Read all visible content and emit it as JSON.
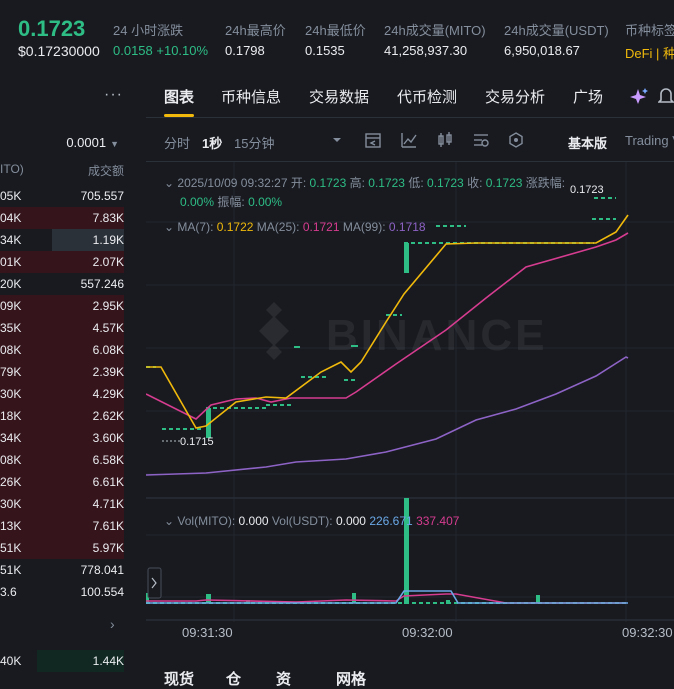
{
  "ticker": {
    "price": "0.1723",
    "price_usd": "$0.17230000",
    "stats": [
      {
        "label": "24 小时涨跌",
        "value": "0.0158 +10.10%"
      },
      {
        "label": "24h最高价",
        "value": "0.1798"
      },
      {
        "label": "24h最低价",
        "value": "0.1535"
      },
      {
        "label": "24h成交量(MITO)",
        "value": "41,258,937.30"
      },
      {
        "label": "24h成交量(USDT)",
        "value": "6,950,018.67"
      },
      {
        "label": "币种标签",
        "value": "DeFi | 种"
      }
    ]
  },
  "orderbook": {
    "more": "···",
    "step": "0.0001",
    "col1": "ITO)",
    "col2": "成交额",
    "rows": [
      {
        "q": "05K",
        "v": "705.557",
        "side": "ask",
        "fill": 0.0
      },
      {
        "q": "04K",
        "v": "7.83K",
        "side": "ask",
        "fill": 1.0
      },
      {
        "q": "34K",
        "v": "1.19K",
        "side": "ask",
        "fill": 0.58
      },
      {
        "q": "01K",
        "v": "2.07K",
        "side": "ask",
        "fill": 1.0
      },
      {
        "q": "20K",
        "v": "557.246",
        "side": "ask",
        "fill": 0.0
      },
      {
        "q": "09K",
        "v": "2.95K",
        "side": "ask",
        "fill": 1.0
      },
      {
        "q": "35K",
        "v": "4.57K",
        "side": "ask",
        "fill": 1.0
      },
      {
        "q": "08K",
        "v": "6.08K",
        "side": "ask",
        "fill": 1.0
      },
      {
        "q": "79K",
        "v": "2.39K",
        "side": "ask",
        "fill": 1.0
      },
      {
        "q": "30K",
        "v": "4.29K",
        "side": "ask",
        "fill": 1.0
      },
      {
        "q": "18K",
        "v": "2.62K",
        "side": "ask",
        "fill": 1.0
      },
      {
        "q": "34K",
        "v": "3.60K",
        "side": "ask",
        "fill": 1.0
      },
      {
        "q": "08K",
        "v": "6.58K",
        "side": "ask",
        "fill": 1.0
      },
      {
        "q": "26K",
        "v": "6.61K",
        "side": "ask",
        "fill": 1.0
      },
      {
        "q": "30K",
        "v": "4.71K",
        "side": "ask",
        "fill": 1.0
      },
      {
        "q": "13K",
        "v": "7.61K",
        "side": "ask",
        "fill": 1.0
      },
      {
        "q": "51K",
        "v": "5.97K",
        "side": "ask",
        "fill": 1.0
      },
      {
        "q": "51K",
        "v": "778.041",
        "side": "ask",
        "fill": 0.0
      },
      {
        "q": "3.6",
        "v": "100.554",
        "side": "ask",
        "fill": 0.0
      }
    ],
    "more_icon": "chevron-right-icon",
    "bid_row": {
      "q": "40K",
      "v": "1.44K",
      "fill": 0.7
    }
  },
  "tabs": [
    "图表",
    "币种信息",
    "交易数据",
    "代币检测",
    "交易分析",
    "广场"
  ],
  "toolbar": {
    "time": "分时",
    "one_sec": "1秒",
    "fifteen_min": "15分钟",
    "basic": "基本版",
    "trading_view": "Trading V"
  },
  "ohlc": {
    "datetime": "2025/10/09 09:32:27",
    "open_label": "开:",
    "open": "0.1723",
    "high_label": "高:",
    "high": "0.1723",
    "low_label": "低:",
    "low": "0.1723",
    "close_label": "收:",
    "close": "0.1723",
    "change_label": "涨跌幅:",
    "change": "0.00%",
    "amp_label": "振幅:",
    "amp": "0.00%"
  },
  "ma": {
    "ma7_label": "MA(7):",
    "ma7": "0.1722",
    "ma25_label": "MA(25):",
    "ma25": "0.1721",
    "ma99_label": "MA(99):",
    "ma99": "0.1718"
  },
  "vol": {
    "mito_label": "Vol(MITO):",
    "mito": "0.000",
    "usdt_label": "Vol(USDT):",
    "usdt": "0.000",
    "v1": "226.671",
    "v2": "337.407"
  },
  "watermark": "BINANCE",
  "high_marker": "0.1723",
  "low_marker": "0.1715",
  "x_labels": [
    "09:31:30",
    "09:32:00",
    "09:32:30"
  ],
  "bottom_tabs": [
    "现货",
    "仓",
    "资",
    "网格"
  ],
  "colors": {
    "up": "#2ebd85",
    "down": "#f6465d",
    "brand": "#f0b90b",
    "ma7": "#f0b90b",
    "ma25": "#d63c8f",
    "ma99": "#8e63c6",
    "bg": "#181a20",
    "panel": "#181a20",
    "muted": "#848e9c"
  }
}
